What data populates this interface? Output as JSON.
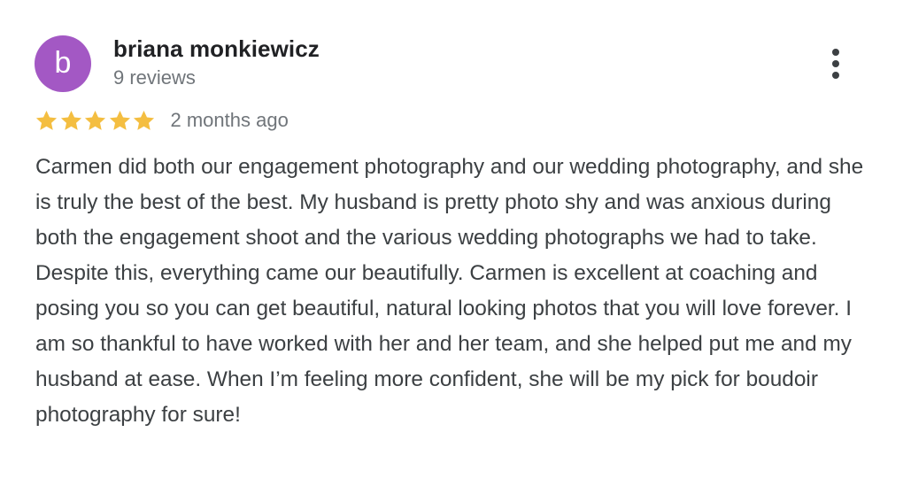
{
  "review": {
    "author": {
      "initial": "b",
      "name": "briana monkiewicz",
      "review_count": "9 reviews",
      "avatar_color": "#a358c4"
    },
    "rating": {
      "stars": 5,
      "max": 5,
      "star_color": "#f4be41"
    },
    "timestamp": "2 months ago",
    "text": "Carmen did both our engagement photography and our wedding photography, and she is truly the best of the best. My husband is pretty photo shy and was anxious during both the engagement shoot and the various wedding photographs we had to take. Despite this, everything came our beautifully. Carmen is excellent at coaching and posing you so you can get beautiful, natural looking photos that you will love forever. I am so thankful to have worked with her and her team, and she helped put me and my husband at ease. When I’m feeling more confident, she will be my pick for boudoir photography for sure!",
    "menu_icon": "more-vert-icon"
  }
}
